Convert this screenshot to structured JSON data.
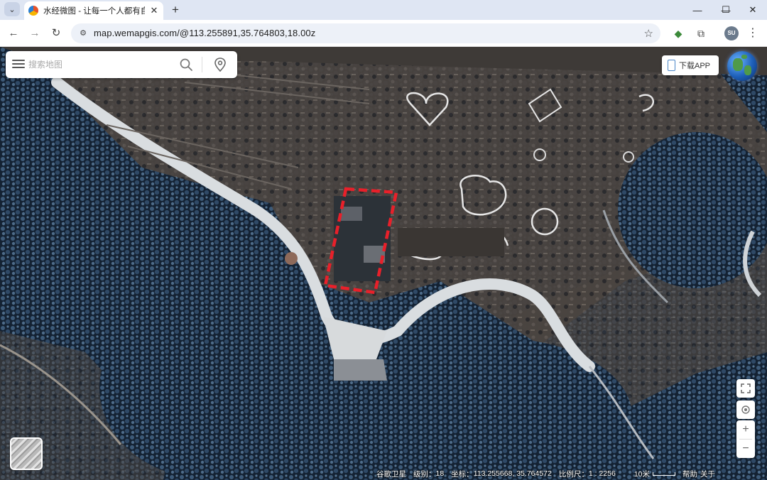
{
  "browser": {
    "tab_title": "水经微图 - 让每一个人都有自己",
    "tab_close": "✕",
    "new_tab": "+",
    "window": {
      "minimize": "—",
      "maximize": "☐",
      "close": "✕"
    },
    "url": "map.wemapgis.com/@113.255891,35.764803,18.00z",
    "profile_initials": "SU"
  },
  "map": {
    "search_placeholder": "搜索地图",
    "download_app": "下载APP",
    "status": {
      "imagery": "谷歌卫星",
      "zoom_label": "级别：",
      "zoom": "18",
      "coord_label": "坐标：",
      "coords": "113.255668, 35.764572",
      "scale_label": "比例尺：",
      "scale": "1 : 2256",
      "scale_bar": "10米",
      "help": "帮助",
      "about": "关于"
    },
    "controls": {
      "zoom_in": "+",
      "zoom_out": "−"
    },
    "highlight_color": "#e8202a"
  }
}
